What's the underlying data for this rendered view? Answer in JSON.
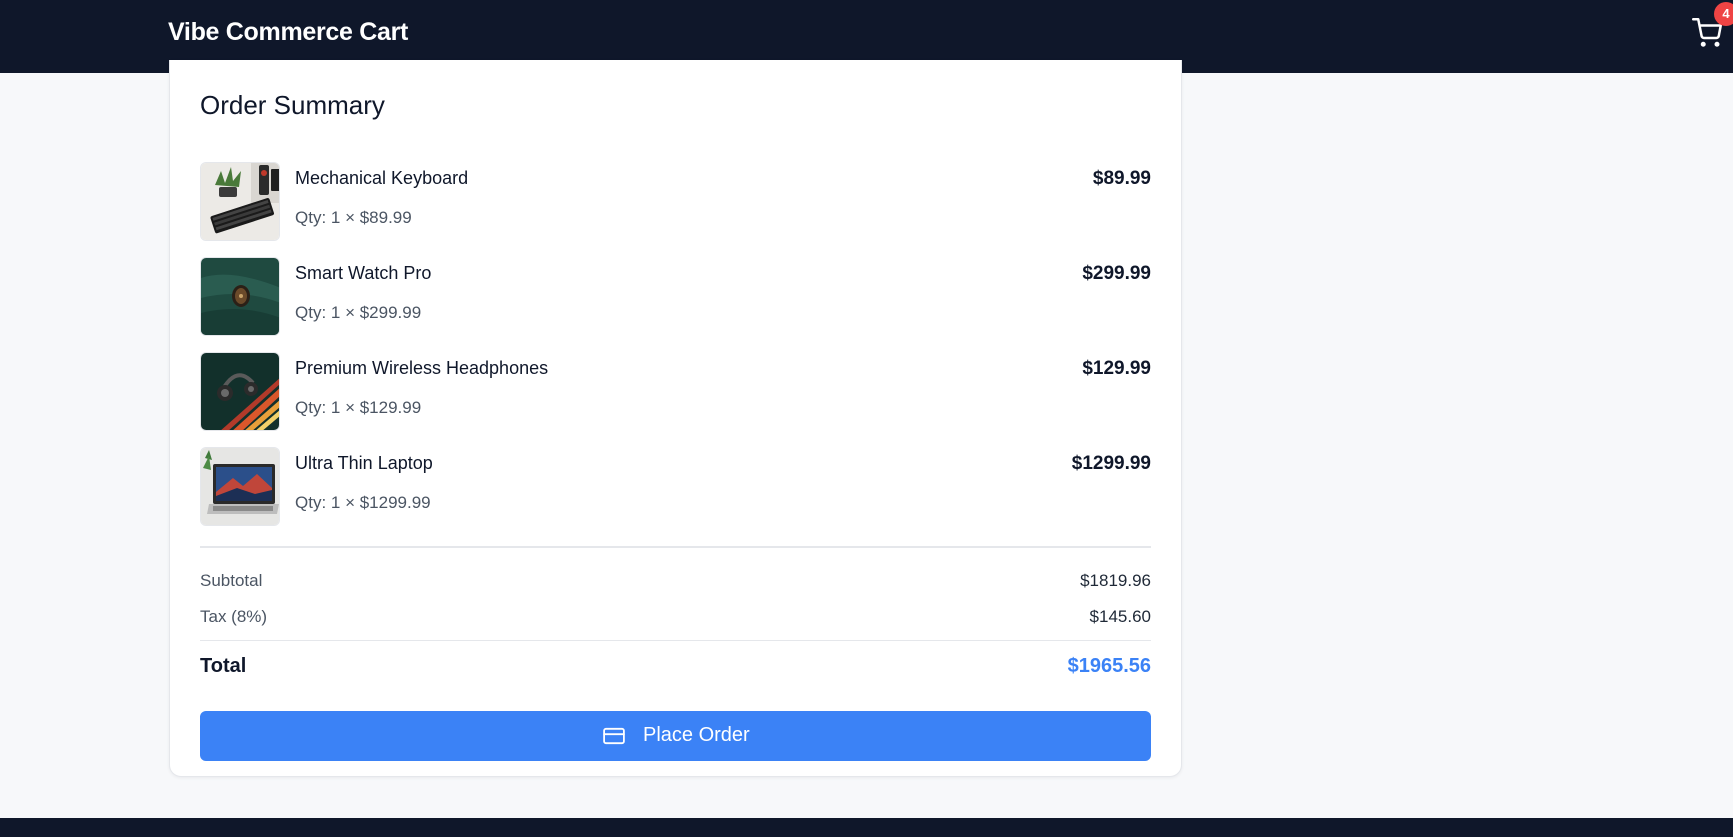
{
  "header": {
    "brand": "Vibe Commerce Cart",
    "cart_icon": "shopping-cart-icon",
    "cart_count": "4",
    "background": "#0f172a"
  },
  "summary": {
    "title": "Order Summary",
    "items": [
      {
        "name": "Mechanical Keyboard",
        "qty": "Qty: 1 × $89.99",
        "price": "$89.99",
        "thumb": "keyboard-photo"
      },
      {
        "name": "Smart Watch Pro",
        "qty": "Qty: 1 × $299.99",
        "price": "$299.99",
        "thumb": "smart-watch-photo"
      },
      {
        "name": "Premium Wireless Headphones",
        "qty": "Qty: 1 × $129.99",
        "price": "$129.99",
        "thumb": "headphones-photo"
      },
      {
        "name": "Ultra Thin Laptop",
        "qty": "Qty: 1 × $1299.99",
        "price": "$1299.99",
        "thumb": "laptop-photo"
      }
    ],
    "subtotal_label": "Subtotal",
    "subtotal_value": "$1819.96",
    "tax_label": "Tax (8%)",
    "tax_value": "$145.60",
    "total_label": "Total",
    "total_value": "$1965.56",
    "place_order_label": "Place Order",
    "place_order_icon": "credit-card-icon"
  },
  "colors": {
    "accent": "#3b82f6",
    "badge": "#ef4444",
    "page_bg": "#f7f8fa"
  }
}
